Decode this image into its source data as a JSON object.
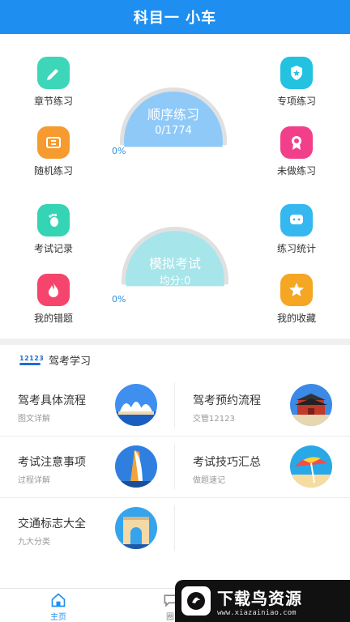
{
  "header": {
    "title": "科目一 小车"
  },
  "practice": {
    "left_features": [
      {
        "label": "章节练习",
        "icon": "pencil-icon",
        "color": "#3dd6b8"
      },
      {
        "label": "随机练习",
        "icon": "ticket-icon",
        "color": "#f59b2f"
      },
      {
        "label": "考试记录",
        "icon": "footprint-icon",
        "color": "#35d4b4"
      },
      {
        "label": "我的错题",
        "icon": "flame-icon",
        "color": "#f5456c"
      }
    ],
    "right_features": [
      {
        "label": "专项练习",
        "icon": "shield-star-icon",
        "color": "#22c2e0"
      },
      {
        "label": "未做练习",
        "icon": "ribbon-icon",
        "color": "#f23f8a"
      },
      {
        "label": "练习统计",
        "icon": "chat-bubble-icon",
        "color": "#35b8ef"
      },
      {
        "label": "我的收藏",
        "icon": "star-icon",
        "color": "#f5a623"
      }
    ],
    "sequential": {
      "title": "顺序练习",
      "progress": "0/1774",
      "percent": "0%",
      "color": "#8fc9f8"
    },
    "mock": {
      "title": "模拟考试",
      "avg": "均分:0",
      "percent": "0%",
      "color": "#a6e5ea"
    }
  },
  "study": {
    "badge": "12123",
    "title": "驾考学习",
    "cards": [
      {
        "title": "驾考具体流程",
        "sub": "图文详解",
        "icon": "opera-house-icon"
      },
      {
        "title": "驾考预约流程",
        "sub": "交管12123",
        "icon": "palace-gate-icon"
      },
      {
        "title": "考试注意事项",
        "sub": "过程详解",
        "icon": "tower-icon"
      },
      {
        "title": "考试技巧汇总",
        "sub": "做题速记",
        "icon": "beach-umbrella-icon"
      },
      {
        "title": "交通标志大全",
        "sub": "九大分类",
        "icon": "arch-icon"
      }
    ]
  },
  "tabs": [
    {
      "label": "主页",
      "icon": "home-icon",
      "active": true
    },
    {
      "label": "圈",
      "icon": "chat-icon",
      "active": false
    }
  ],
  "watermark": {
    "main": "下载鸟资源",
    "url": "www.xiazainiao.com"
  },
  "colors": {
    "primary": "#1e8ff0"
  }
}
